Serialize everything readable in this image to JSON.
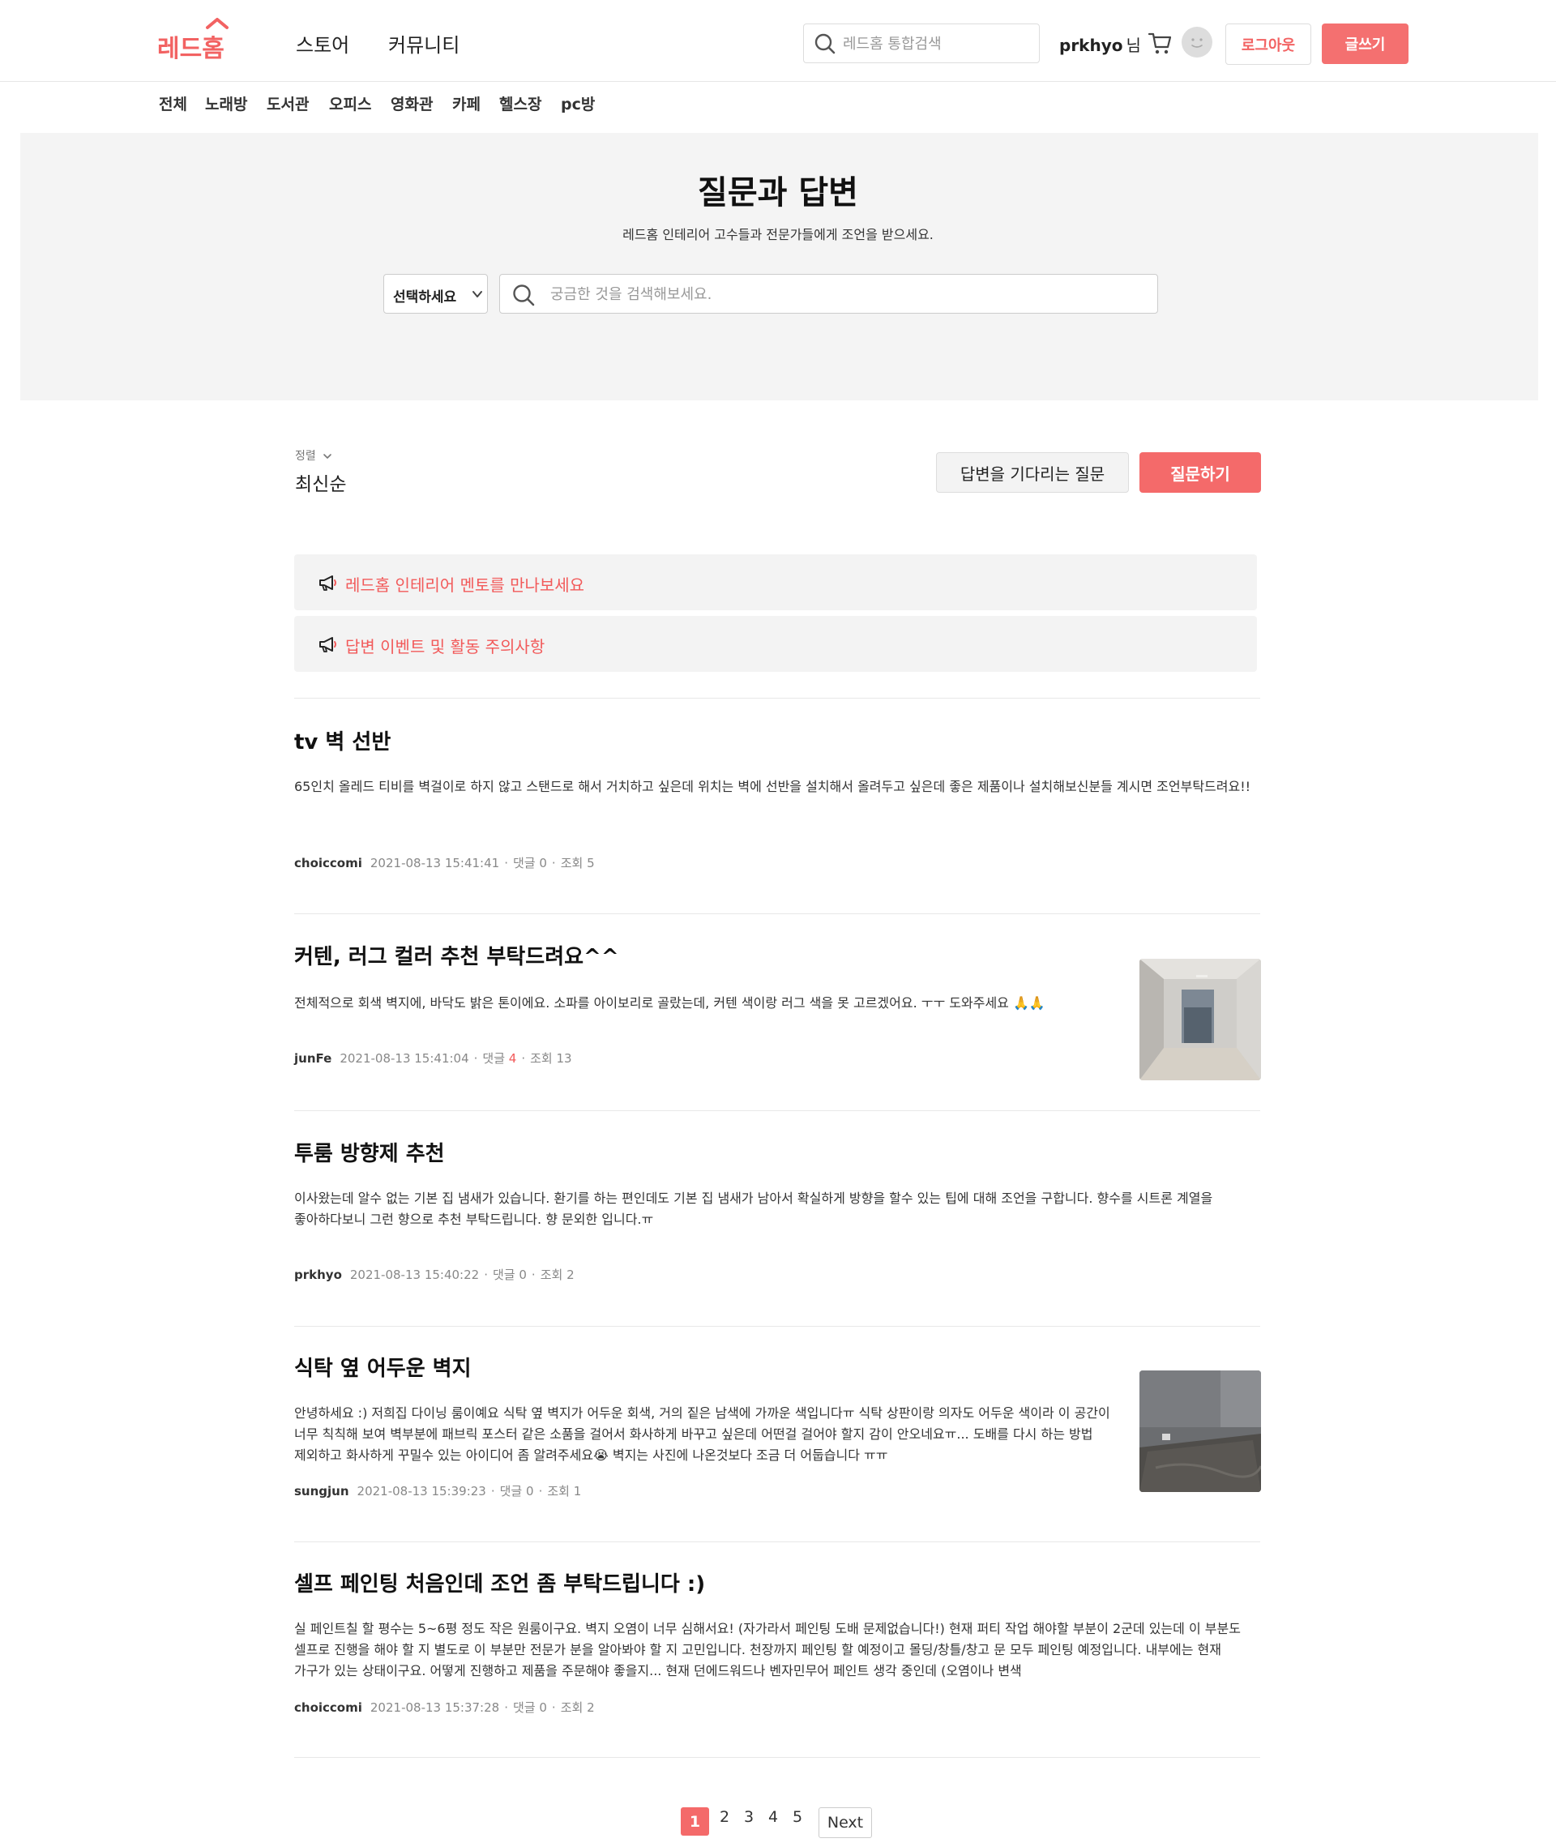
{
  "header": {
    "logo_text": "레드홈",
    "nav": [
      "스토어",
      "커뮤니티"
    ],
    "search_placeholder": "레드홈 통합검색",
    "user_name": "prkhyo",
    "user_suffix": "님",
    "logout_label": "로그아웃",
    "write_label": "글쓰기"
  },
  "categories": [
    "전체",
    "노래방",
    "도서관",
    "오피스",
    "영화관",
    "카페",
    "헬스장",
    "pc방"
  ],
  "hero": {
    "title": "질문과 답변",
    "subtitle": "레드홈 인테리어 고수들과 전문가들에게 조언을 받으세요.",
    "select_label": "선택하세요",
    "search_placeholder": "궁금한 것을 검색해보세요."
  },
  "sort": {
    "label": "정렬",
    "value": "최신순"
  },
  "actions": {
    "waiting_label": "답변을 기다리는 질문",
    "ask_label": "질문하기"
  },
  "notices": [
    "레드홈 인테리어 멘토를 만나보세요",
    "답변 이벤트 및 활동 주의사항"
  ],
  "posts": [
    {
      "title": "tv 벽 선반",
      "body": "65인치 올레드 티비를 벽걸이로 하지 않고 스탠드로 해서 거치하고 싶은데 위치는 벽에 선반을 설치해서 올려두고 싶은데 좋은 제품이나 설치해보신분들 계시면 조언부탁드려요!!",
      "author": "choiccomi",
      "date": "2021-08-13 15:41:41",
      "comments_label": "댓글",
      "comments": "0",
      "views_label": "조회",
      "views": "5"
    },
    {
      "title": "커텐, 러그 컬러 추천 부탁드려요^^",
      "body": "전체적으로 회색 벽지에, 바닥도 밝은 톤이에요. 소파를 아이보리로 골랐는데, 커텐 색이랑 러그 색을 못 고르겠어요. ㅜㅜ 도와주세요 🙏🙏",
      "author": "junFe",
      "date": "2021-08-13 15:41:04",
      "comments_label": "댓글",
      "comments": "4",
      "views_label": "조회",
      "views": "13"
    },
    {
      "title": "투룸 방향제 추천",
      "body": "이사왔는데 알수 없는 기본 집 냄새가 있습니다. 환기를 하는 편인데도 기본 집 냄새가 남아서 확실하게 방향을 할수 있는 팁에 대해 조언을 구합니다. 향수를 시트론 계열을 좋아하다보니 그런 향으로 추천 부탁드립니다. 향 문외한 입니다.ㅠ",
      "author": "prkhyo",
      "date": "2021-08-13 15:40:22",
      "comments_label": "댓글",
      "comments": "0",
      "views_label": "조회",
      "views": "2"
    },
    {
      "title": "식탁 옆 어두운 벽지",
      "body": "안녕하세요 :) 저희집 다이닝 룸이예요 식탁 옆 벽지가 어두운 회색, 거의 짙은 남색에 가까운 색입니다ㅠ 식탁 상판이랑 의자도 어두운 색이라 이 공간이 너무 칙칙해 보여 벽부분에 패브릭 포스터 같은 소품을 걸어서 화사하게 바꾸고 싶은데 어떤걸 걸어야 할지 감이 안오네요ㅠ... 도배를 다시 하는 방법 제외하고 화사하게 꾸밀수 있는 아이디어 좀 알려주세요😭 벽지는 사진에 나온것보다 조금 더 어둡습니다 ㅠㅠ",
      "author": "sungjun",
      "date": "2021-08-13 15:39:23",
      "comments_label": "댓글",
      "comments": "0",
      "views_label": "조회",
      "views": "1"
    },
    {
      "title": "셀프 페인팅 처음인데 조언 좀 부탁드립니다 :)",
      "body": "실 페인트칠 할 평수는 5~6평 정도 작은 원룸이구요. 벽지 오염이 너무 심해서요! (자가라서 페인팅 도배 문제없습니다!) 현재 퍼티 작업 해야할 부분이 2군데 있는데 이 부분도 셀프로 진행을 해야 할 지 별도로 이 부분만 전문가 분을 알아봐야 할 지 고민입니다. 천장까지 페인팅 할 예정이고 몰딩/창틀/창고 문 모두 페인팅 예정입니다. 내부에는 현재 가구가 있는 상태이구요. 어떻게 진행하고 제품을 주문해야 좋을지... 현재 던에드워드나 벤자민무어 페인트 생각 중인데 (오염이나 변색",
      "author": "choiccomi",
      "date": "2021-08-13 15:37:28",
      "comments_label": "댓글",
      "comments": "0",
      "views_label": "조회",
      "views": "2"
    }
  ],
  "pagination": {
    "current": "1",
    "pages": [
      "2",
      "3",
      "4",
      "5"
    ],
    "next_label": "Next"
  },
  "colors": {
    "accent": "#f46a6a",
    "notice_text": "#f25a5a",
    "hero_bg": "#f4f4f4"
  }
}
